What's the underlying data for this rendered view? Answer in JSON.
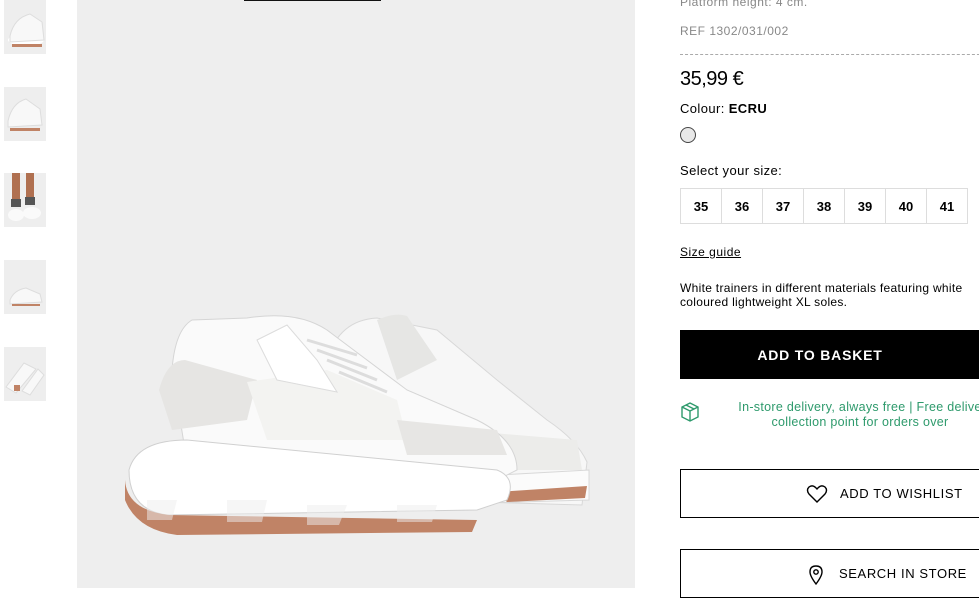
{
  "product": {
    "platform_height": "Platform height: 4 cm.",
    "ref": "REF 1302/031/002",
    "price": "35,99 €",
    "colour_label": "Colour:",
    "colour_value": "ECRU",
    "swatch_color": "#e8e8e8",
    "select_size_label": "Select your size:",
    "sizes": [
      "35",
      "36",
      "37",
      "38",
      "39",
      "40",
      "41"
    ],
    "size_guide": "Size guide",
    "description_line1": "White trainers in different materials featuring white",
    "description_line2": "coloured lightweight XL soles.",
    "add_to_basket": "ADD TO BASKET",
    "delivery_line1": "In-store delivery, always free | Free delive",
    "delivery_line2": "collection point for orders over",
    "add_to_wishlist": "ADD TO WISHLIST",
    "search_in_store": "SEARCH IN STORE"
  },
  "gallery": {
    "thumbnails": [
      "thumb-1",
      "thumb-2",
      "thumb-3",
      "thumb-4",
      "thumb-5"
    ],
    "main_image": "sneaker-image"
  },
  "colors": {
    "accent_green": "#2e9a6c",
    "sole_brown": "#c08366",
    "background_grey": "#eeeeee"
  }
}
